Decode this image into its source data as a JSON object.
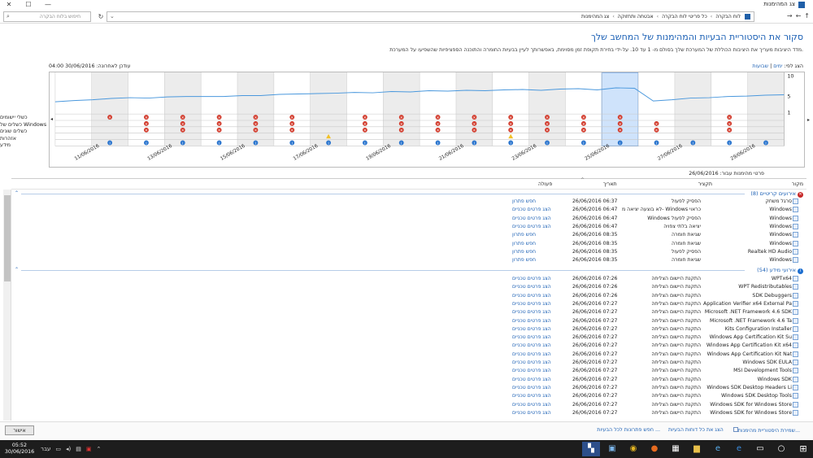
{
  "window": {
    "title": "צג המהימנות",
    "btn_min": "—",
    "btn_max": "☐",
    "btn_close": "✕"
  },
  "address": {
    "search_placeholder": "חיפוש בלוח הבקרה",
    "crumbs": [
      "לוח הבקרה",
      "כל פריטי לוח הבקרה",
      "אבטחה ותחזוקה",
      "צג המהימנות"
    ]
  },
  "header": {
    "title": "סקור את היסטוריית הבעיות והמהימנות של המחשב שלך",
    "description": "מדד היציבות מעריך את היציבות הכוללת של המערכת שלך בסולם מ- 1 עד 10. על-ידי בחירת תקופת זמן מסוימת, באפשרותך לעיין בבעיות החומרה והתוכנה הספציפיות שהשפיעו על המערכת.",
    "view_by_label": "הצג לפי:",
    "view_days": "ימים",
    "view_sep": "|",
    "view_weeks": "שבועות",
    "last_updated": "עודכן לאחרונה: 30/06/2016 04:00"
  },
  "chart_data": {
    "type": "line",
    "y_ticks": [
      "10",
      "5",
      "1"
    ],
    "ylim": [
      1,
      10
    ],
    "row_labels": [
      "כשלי יישומים",
      "כשלים של Windows",
      "כשלים שונים",
      "אזהרות",
      "מידע"
    ],
    "x_labels": [
      "11/06/2016",
      "13/06/2016",
      "15/06/2016",
      "17/06/2016",
      "19/06/2016",
      "21/06/2016",
      "23/06/2016",
      "25/06/2016",
      "27/06/2016",
      "29/06/2016"
    ],
    "columns": 20,
    "selected_column": 15,
    "stability": [
      3.6,
      3.9,
      4.1,
      4.4,
      4.6,
      4.5,
      4.8,
      4.9,
      4.9,
      4.9,
      5.1,
      5.1,
      5.4,
      5.5,
      5.6,
      5.7,
      5.9,
      5.8,
      6.1,
      6.0,
      6.3,
      6.2,
      6.4,
      6.3,
      6.5,
      6.6,
      6.4,
      6.7,
      6.8,
      6.5,
      7.0,
      6.9,
      3.8,
      4.1,
      4.5,
      4.6,
      4.9,
      5.0,
      5.2,
      5.3
    ],
    "app_fail_cols": [
      1,
      2,
      3,
      4,
      5,
      6,
      8,
      9,
      10,
      11,
      12,
      13,
      14,
      15,
      18
    ],
    "win_fail_cols": [
      2,
      3,
      4,
      5,
      6,
      8,
      9,
      10,
      11,
      12,
      13,
      14,
      15,
      16,
      18
    ],
    "misc_fail_cols": [
      2,
      3,
      4,
      5,
      6,
      8,
      9,
      10,
      11,
      12,
      13,
      14,
      15,
      16,
      18
    ],
    "warn_cols": [
      7,
      12
    ],
    "info_cols": [
      1,
      2,
      3,
      4,
      5,
      6,
      7,
      8,
      9,
      10,
      11,
      12,
      13,
      14,
      15,
      16,
      17,
      18,
      19
    ]
  },
  "details": {
    "for_label": "פרטי מהימנות עבור: 26/06/2016",
    "col_source": "מקור",
    "col_summary": "תקציר",
    "col_date": "תאריך",
    "col_action": "פעולה",
    "critical_group": "אירועים קריטיים (8)",
    "info_group": "אירועי מידע (54)",
    "critical_rows": [
      {
        "source": "סרגל משחק",
        "summary": "הפסיק לפעול",
        "date": "26/06/2016 06:37",
        "action": "חפש פתרון"
      },
      {
        "source": "Windows",
        "summary": "לא בוצעה יציאה מ- Windows כראוי",
        "date": "26/06/2016 06:47",
        "action": "הצג פרטים טכניים"
      },
      {
        "source": "Windows",
        "summary": "Windows הפסיק לפעול",
        "date": "26/06/2016 06:47",
        "action": "הצג פרטים טכניים"
      },
      {
        "source": "Windows",
        "summary": "יציאה בלתי צפויה",
        "date": "26/06/2016 06:47",
        "action": "הצג פרטים טכניים"
      },
      {
        "source": "Windows",
        "summary": "שגיאת חומרה",
        "date": "26/06/2016 08:35",
        "action": "חפש פתרון"
      },
      {
        "source": "Windows",
        "summary": "שגיאת חומרה",
        "date": "26/06/2016 08:35",
        "action": "חפש פתרון"
      },
      {
        "source": "Realtek HD Audio",
        "summary": "הפסיק לפעול",
        "date": "26/06/2016 08:35",
        "action": "חפש פתרון"
      },
      {
        "source": "Windows",
        "summary": "שגיאת חומרה",
        "date": "26/06/2016 08:35",
        "action": "חפש פתרון"
      }
    ],
    "info_rows": [
      {
        "source": "WPTx64",
        "summary": "התקנת היישום הצליחה",
        "date": "26/06/2016 07:26",
        "action": "הצג פרטים טכניים"
      },
      {
        "source": "WPT Redistributables",
        "summary": "התקנת היישום הצליחה",
        "date": "26/06/2016 07:26",
        "action": "הצג פרטים טכניים"
      },
      {
        "source": "SDK Debuggers",
        "summary": "התקנת היישום הצליחה",
        "date": "26/06/2016 07:26",
        "action": "הצג פרטים טכניים"
      },
      {
        "source": "Application Verifier x64 External Pa",
        "summary": "התקנת היישום הצליחה",
        "date": "26/06/2016 07:27",
        "action": "הצג פרטים טכניים"
      },
      {
        "source": "Microsoft .NET Framework 4.6 SDK",
        "summary": "התקנת היישום הצליחה",
        "date": "26/06/2016 07:27",
        "action": "הצג פרטים טכניים"
      },
      {
        "source": "Microsoft .NET Framework 4.6 Ta",
        "summary": "התקנת היישום הצליחה",
        "date": "26/06/2016 07:27",
        "action": "הצג פרטים טכניים"
      },
      {
        "source": "Kits Configuration Installer",
        "summary": "התקנת היישום הצליחה",
        "date": "26/06/2016 07:27",
        "action": "הצג פרטים טכניים"
      },
      {
        "source": "Windows App Certification Kit Su",
        "summary": "התקנת היישום הצליחה",
        "date": "26/06/2016 07:27",
        "action": "הצג פרטים טכניים"
      },
      {
        "source": "Windows App Certification Kit x64",
        "summary": "התקנת היישום הצליחה",
        "date": "26/06/2016 07:27",
        "action": "הצג פרטים טכניים"
      },
      {
        "source": "Windows App Certification Kit Nat",
        "summary": "התקנת היישום הצליחה",
        "date": "26/06/2016 07:27",
        "action": "הצג פרטים טכניים"
      },
      {
        "source": "Windows SDK EULA",
        "summary": "התקנת היישום הצליחה",
        "date": "26/06/2016 07:27",
        "action": "הצג פרטים טכניים"
      },
      {
        "source": "MSI Development Tools",
        "summary": "התקנת היישום הצליחה",
        "date": "26/06/2016 07:27",
        "action": "הצג פרטים טכניים"
      },
      {
        "source": "Windows SDK",
        "summary": "התקנת היישום הצליחה",
        "date": "26/06/2016 07:27",
        "action": "הצג פרטים טכניים"
      },
      {
        "source": "Windows SDK Desktop Headers Li",
        "summary": "התקנת היישום הצליחה",
        "date": "26/06/2016 07:27",
        "action": "הצג פרטים טכניים"
      },
      {
        "source": "Windows SDK Desktop Tools",
        "summary": "התקנת היישום הצליחה",
        "date": "26/06/2016 07:27",
        "action": "הצג פרטים טכניים"
      },
      {
        "source": "Windows SDK for Windows Store",
        "summary": "התקנת היישום הצליחה",
        "date": "26/06/2016 07:27",
        "action": "הצג פרטים טכניים"
      },
      {
        "source": "Windows SDK for Windows Store",
        "summary": "התקנת היישום הצליחה",
        "date": "26/06/2016 07:27",
        "action": "הצג פרטים טכניים"
      }
    ]
  },
  "footer": {
    "ok": "אישור",
    "save_history": "שמירת היסטוריית מהימנות...",
    "view_all_reports": "הצג את כל דוחות הבעיות",
    "check_solutions": "חפש פתרונות לכל הבעיות ..."
  },
  "taskbar": {
    "time": "05:52",
    "date": "30/06/2016",
    "lang": "עבר"
  }
}
